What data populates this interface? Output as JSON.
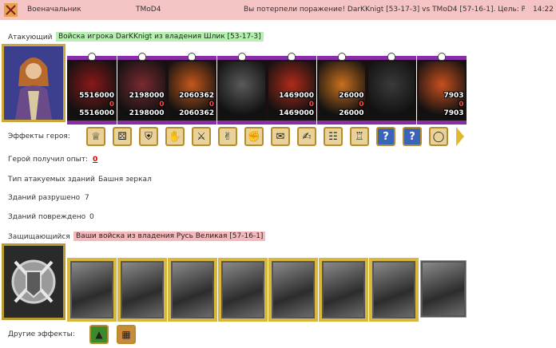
{
  "topbar": {
    "role": "Военачальник",
    "name": "TMoD4",
    "message": "Вы потерпели поражение! DarKKnigt [53-17-3] vs TMoD4 [57-16-1]. Цель: Ра...",
    "time": "14:22"
  },
  "attacker": {
    "label": "Атакующий",
    "army": "Войска игрока DarKKnigt из владения Шлик [53-17-3]",
    "units": [
      {
        "total": "5516000",
        "lost": "0",
        "left": "5516000",
        "color": "#8a1818"
      },
      {
        "total": "2198000",
        "lost": "0",
        "left": "2198000",
        "color": "#7a2a30"
      },
      {
        "total": "2060362",
        "lost": "0",
        "left": "2060362",
        "color": "#c4581a"
      },
      {
        "total": "",
        "lost": "",
        "left": "",
        "color": "#5a5a5a"
      },
      {
        "total": "1469000",
        "lost": "0",
        "left": "1469000",
        "color": "#b02a1a"
      },
      {
        "total": "26000",
        "lost": "0",
        "left": "26000",
        "color": "#c9701e"
      },
      {
        "total": "",
        "lost": "",
        "left": "",
        "color": "#3a3a3a"
      },
      {
        "total": "7903",
        "lost": "0",
        "left": "7903",
        "color": "#c8501e"
      }
    ]
  },
  "hero_effects": {
    "label": "Эффекты героя:",
    "icons": [
      "helmet-icon",
      "dice-icon",
      "shield-icon",
      "hand-shield-icon",
      "sword-icon",
      "handshake-icon",
      "fist-icon",
      "scroll-icon",
      "arm-icon",
      "book-icon",
      "armor-icon",
      "question-icon",
      "question-icon",
      "ring-icon"
    ]
  },
  "experience": {
    "label": "Герой получил опыт:",
    "value": "0"
  },
  "building_type": {
    "label": "Тип атакуемых зданий",
    "value": "Башня зеркал"
  },
  "destroyed": {
    "label": "Зданий разрушено",
    "value": "7"
  },
  "damaged": {
    "label": "Зданий повреждено",
    "value": "0"
  },
  "defender": {
    "label": "Защищающийся",
    "army": "Ваши войска из владения Русь Великая [57-16-1]"
  },
  "other_effects": {
    "label": "Другие эффекты:"
  },
  "colors": {
    "topbar": "#f4c3c4",
    "green_tag": "#b8f0b4",
    "red_tag": "#f4b9ba",
    "unit_border": "#8a2da8",
    "gold": "#d8b73c"
  }
}
